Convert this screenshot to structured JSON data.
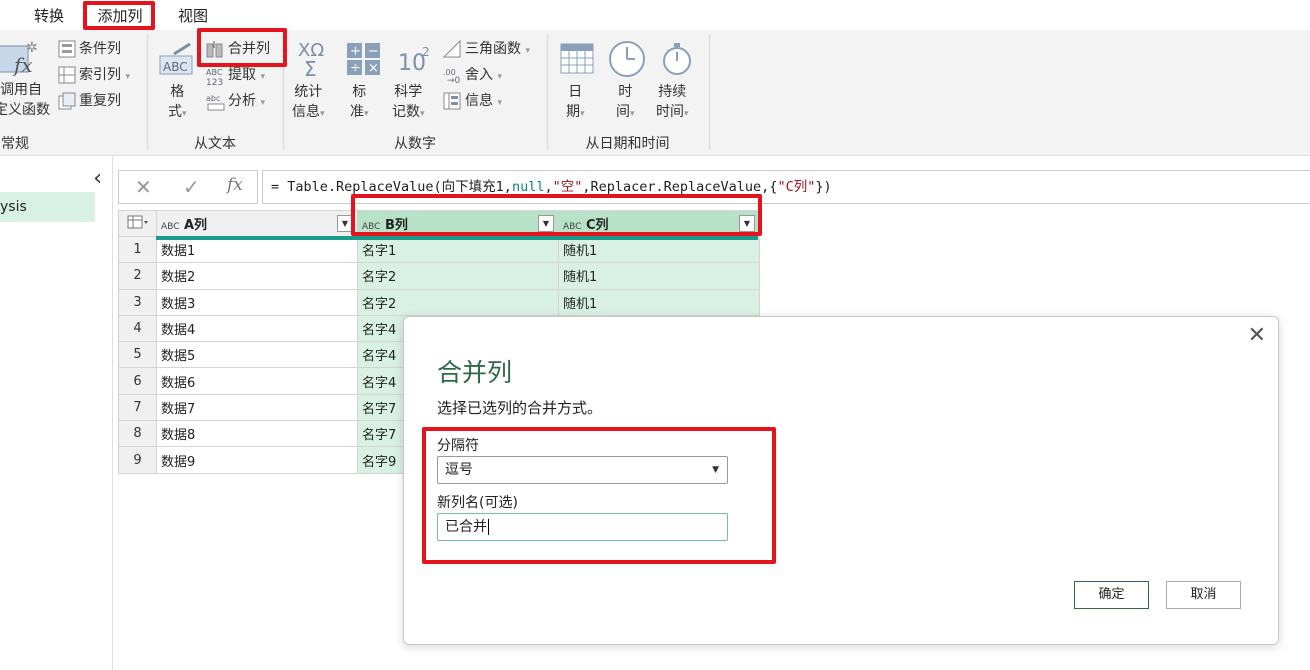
{
  "tabs": {
    "transform": "转换",
    "add_column": "添加列",
    "view": "视图"
  },
  "ribbon": {
    "general": {
      "label": "常规",
      "invoke_custom_line1": "调用自",
      "invoke_custom_line2": "定义函数",
      "conditional": "条件列",
      "index": "索引列",
      "duplicate": "重复列"
    },
    "from_text": {
      "label": "从文本",
      "format_line1": "格",
      "format_line2": "式",
      "merge": "合并列",
      "extract": "提取",
      "parse": "分析"
    },
    "from_number": {
      "label": "从数字",
      "stats_line1": "统计",
      "stats_line2": "信息",
      "standard_line1": "标",
      "standard_line2": "准",
      "scientific_line1": "科学",
      "scientific_line2": "记数",
      "trig": "三角函数",
      "rounding": "舍入",
      "info": "信息"
    },
    "from_datetime": {
      "label": "从日期和时间",
      "date_line1": "日",
      "date_line2": "期",
      "time_line1": "时",
      "time_line2": "间",
      "duration_line1": "持续",
      "duration_line2": "时间"
    }
  },
  "nav": {
    "item": "ysis",
    "collapse_glyph": "‹"
  },
  "formula": {
    "prefix": "= Table.ReplaceValue(向下填充1,",
    "null": "null",
    "comma1": ",",
    "str1": "\"空\"",
    "mid": ",Replacer.ReplaceValue,{",
    "str2": "\"C列\"",
    "suffix": "})"
  },
  "grid": {
    "headers": [
      "A列",
      "B列",
      "C列"
    ],
    "type_icon": "ABC",
    "rows": [
      {
        "n": "1",
        "a": "数据1",
        "b": "名字1",
        "c": "随机1"
      },
      {
        "n": "2",
        "a": "数据2",
        "b": "名字2",
        "c": "随机1"
      },
      {
        "n": "3",
        "a": "数据3",
        "b": "名字2",
        "c": "随机1"
      },
      {
        "n": "4",
        "a": "数据4",
        "b": "名字4",
        "c": ""
      },
      {
        "n": "5",
        "a": "数据5",
        "b": "名字4",
        "c": ""
      },
      {
        "n": "6",
        "a": "数据6",
        "b": "名字4",
        "c": ""
      },
      {
        "n": "7",
        "a": "数据7",
        "b": "名字7",
        "c": ""
      },
      {
        "n": "8",
        "a": "数据8",
        "b": "名字7",
        "c": ""
      },
      {
        "n": "9",
        "a": "数据9",
        "b": "名字9",
        "c": ""
      }
    ]
  },
  "dialog": {
    "title": "合并列",
    "subtitle": "选择已选列的合并方式。",
    "separator_label": "分隔符",
    "separator_value": "逗号",
    "new_name_label": "新列名(可选)",
    "new_name_value": "已合并",
    "ok": "确定",
    "cancel": "取消",
    "close": "✕"
  },
  "colors": {
    "highlight": "#e3141d",
    "accent": "#2e6a44",
    "column_selected": "#d9f0e4"
  }
}
